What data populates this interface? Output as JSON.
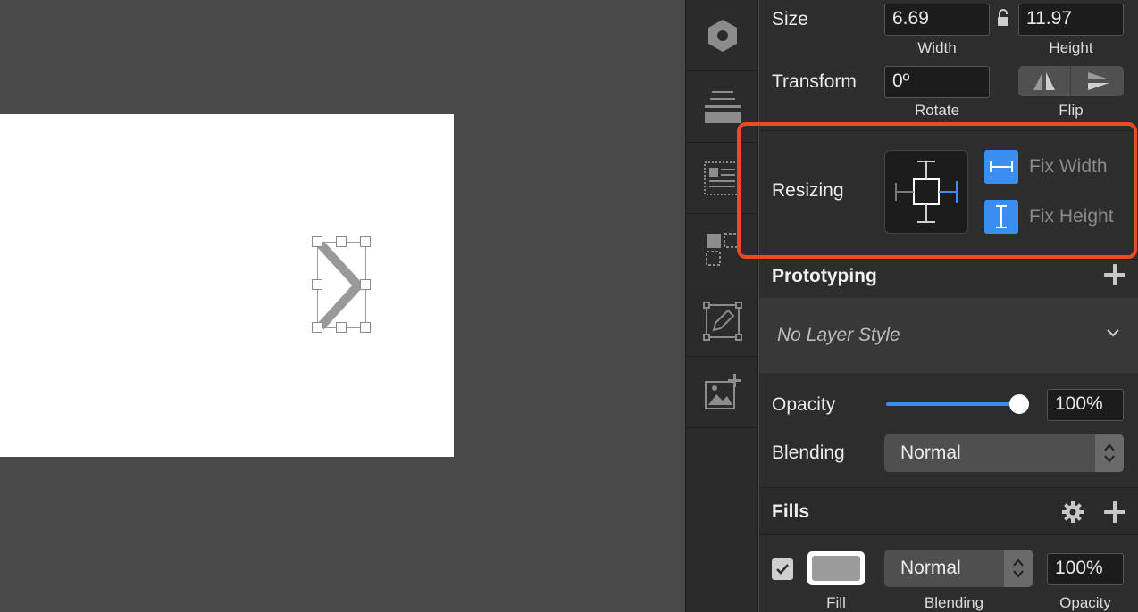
{
  "size": {
    "label": "Size",
    "width_value": "6.69",
    "height_value": "11.97",
    "width_label": "Width",
    "height_label": "Height"
  },
  "transform": {
    "label": "Transform",
    "rotate_value": "0º",
    "rotate_label": "Rotate",
    "flip_label": "Flip"
  },
  "resizing": {
    "label": "Resizing",
    "fix_width_label": "Fix Width",
    "fix_height_label": "Fix Height"
  },
  "prototyping": {
    "title": "Prototyping"
  },
  "layer_style": {
    "placeholder": "No Layer Style"
  },
  "opacity": {
    "label": "Opacity",
    "value": "100%",
    "level": 1.0
  },
  "blending": {
    "label": "Blending",
    "value": "Normal"
  },
  "fills": {
    "title": "Fills",
    "items": [
      {
        "enabled": true,
        "color": "#9b9b9b",
        "blend_value": "Normal",
        "opacity_value": "100%"
      }
    ],
    "fill_label": "Fill",
    "blending_label": "Blending",
    "opacity_label": "Opacity"
  },
  "icons": [
    "symbol-hex-icon",
    "align-icon",
    "text-layout-icon",
    "components-icon",
    "edit-shape-icon",
    "add-image-icon",
    "lock-icon",
    "flip-horizontal-icon",
    "flip-vertical-icon",
    "chevron-down-icon",
    "gear-icon",
    "plus-icon"
  ],
  "colors": {
    "accent": "#3a8ef0",
    "highlight": "#ec4a25",
    "panel": "#2d2d2d",
    "canvas": "#4a4a4a"
  }
}
